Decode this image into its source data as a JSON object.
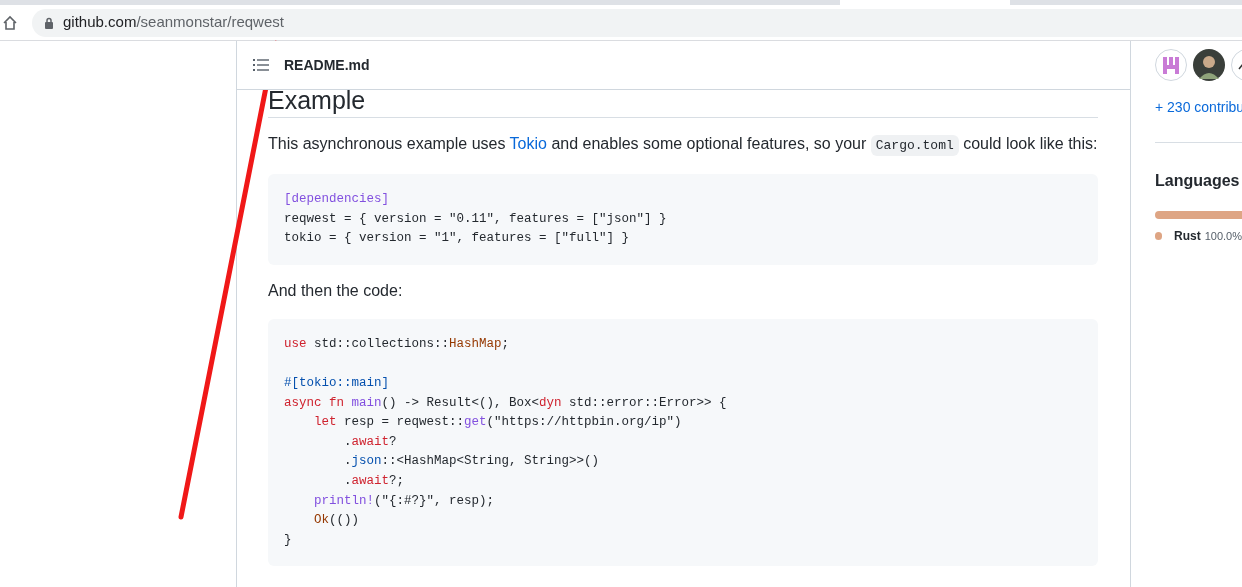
{
  "browser": {
    "url_host": "github.com",
    "url_path": "/seanmonstar/reqwest"
  },
  "readme": {
    "file_name": "README.md",
    "heading": "Example",
    "blocks": [
      {
        "kind": "paragraph",
        "segments": [
          {
            "kind": "text",
            "text": "This asynchronous example uses "
          },
          {
            "kind": "link",
            "text": "Tokio"
          },
          {
            "kind": "text",
            "text": " and enables some optional features, so your "
          },
          {
            "kind": "code",
            "text": "Cargo.toml"
          },
          {
            "kind": "text",
            "text": " could look like this:"
          }
        ]
      },
      {
        "kind": "code",
        "lines": [
          [
            {
              "kind": "entity",
              "text": "[dependencies]"
            }
          ],
          [
            {
              "kind": "plain",
              "text": "reqwest = { version = \"0.11\", features = [\"json\"] }"
            }
          ],
          [
            {
              "kind": "plain",
              "text": "tokio = { version = \"1\", features = [\"full\"] }"
            }
          ]
        ]
      },
      {
        "kind": "paragraph",
        "segments": [
          {
            "kind": "text",
            "text": "And then the code:"
          }
        ]
      },
      {
        "kind": "code",
        "lines": [
          [
            {
              "kind": "keyword",
              "text": "use"
            },
            {
              "kind": "plain",
              "text": " std::collections::"
            },
            {
              "kind": "type",
              "text": "HashMap"
            },
            {
              "kind": "plain",
              "text": ";"
            }
          ],
          [
            {
              "kind": "blank"
            }
          ],
          [
            {
              "kind": "attribute",
              "text": "#[tokio::main]"
            }
          ],
          [
            {
              "kind": "keyword",
              "text": "async fn "
            },
            {
              "kind": "entity",
              "text": "main"
            },
            {
              "kind": "plain",
              "text": "() -> Result<(), Box<"
            },
            {
              "kind": "keyword",
              "text": "dyn"
            },
            {
              "kind": "plain",
              "text": " std::error::Error>> {"
            }
          ],
          [
            {
              "kind": "keyword",
              "text": "    let"
            },
            {
              "kind": "plain",
              "text": " resp = reqwest::"
            },
            {
              "kind": "entity",
              "text": "get"
            },
            {
              "kind": "plain",
              "text": "(\"https://httpbin.org/ip\")"
            }
          ],
          [
            {
              "kind": "plain",
              "text": "        ."
            },
            {
              "kind": "keyword",
              "text": "await"
            },
            {
              "kind": "plain",
              "text": "?"
            }
          ],
          [
            {
              "kind": "plain",
              "text": "        ."
            },
            {
              "kind": "attribute",
              "text": "json"
            },
            {
              "kind": "plain",
              "text": "::<HashMap<String, String>>()"
            }
          ],
          [
            {
              "kind": "plain",
              "text": "        ."
            },
            {
              "kind": "keyword",
              "text": "await"
            },
            {
              "kind": "plain",
              "text": "?;"
            }
          ],
          [
            {
              "kind": "entity",
              "text": "    println!"
            },
            {
              "kind": "plain",
              "text": "(\"{:#?}\", resp);"
            }
          ],
          [
            {
              "kind": "type",
              "text": "    Ok"
            },
            {
              "kind": "plain",
              "text": "(())"
            }
          ],
          [
            {
              "kind": "plain",
              "text": "}"
            }
          ]
        ]
      }
    ]
  },
  "sidebar": {
    "contributors_link": "+ 230 contribu",
    "languages_heading": "Languages",
    "languages": [
      {
        "name": "Rust",
        "percent": "100.0%",
        "color": "#dea584",
        "level": 1
      }
    ]
  }
}
